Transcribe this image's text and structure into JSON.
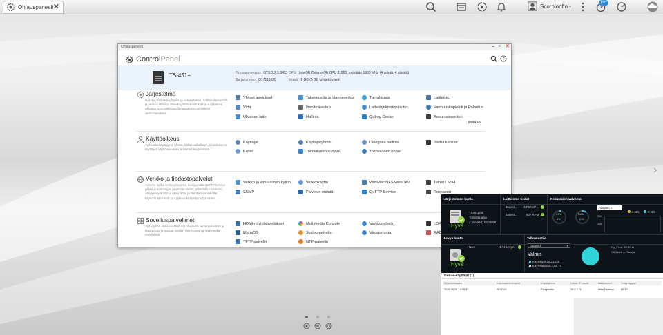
{
  "topbar": {
    "tab_label": "Ohjauspaneeli",
    "username": "Scorpionfin",
    "notification_count": "10+"
  },
  "window": {
    "title": "Ohjauspaneeli",
    "app_name_1": "Control",
    "app_name_2": "Panel",
    "nas_name": "TS-451+",
    "firmware_label": "Firmware-versio:",
    "firmware_value": "QTS 5.2.5.3451",
    "serial_label": "Sarjanumero:",
    "serial_value": "Q17116635",
    "cpu_label": "CPU:",
    "cpu_value": "Intel(R) Celeron(R) CPU J1900, enintään 1900 MHz (4 ydintä, 4 säiettä)",
    "memory_label": "Muisti:",
    "memory_value": "8 GB (8 GB käytettävissä)"
  },
  "sections": [
    {
      "title": "Järjestelmä",
      "desc": "Voit muuttaa aikavyöhyke- ja kieliasetuksia, hallita tallennustila ja ulkoisia laitteita, ottaa käyttöön ilmoitukset ja suojauksen, päivittää NAS-laitteistoa ja palauttaa NAS-laitteen oletusasetukset.",
      "items": [
        "Yleiset asetukset",
        "Tallennustila ja tilannevedos",
        "Turvallisuus",
        "Laitteisto",
        "Virta",
        "Ilmoituskeskus",
        "Laiteohjelmistopäivitys",
        "Varmuuskopiointi ja Palautus",
        "Ulkoinen laite",
        "Hallinta",
        "QuLog Center",
        "Resurssimonitori"
      ],
      "more": "lisää>>"
    },
    {
      "title": "Käyttöoikeus",
      "desc": "Voit luoda käyttäjiä ja ryhmiä, hallita paikallisten ja toimialueen käyttäjien käyttöoikeuksia ja asettaa levykiintiöitä.",
      "items": [
        "Käyttäjät",
        "Käyttäjäryhmät",
        "Delegoitu hallinta",
        "Jaetut kansiot",
        "Kiintiö",
        "Toimialueen suojaus",
        "Toimialueen ohjain"
      ]
    },
    {
      "title": "Verkko ja tiedostopalvelut",
      "desc": "Voimme hallita verkkoyhteyksiä, konfiguroida QuFTP Service -palvelun tiedostojen jakamista varten, määrittää roskakorin säilytyskäytäntöjä ja ottaa NFS- ja WebDAV-protokollat käyttöön Microsoft- ja Apple-verkkoympäristöjä varten.",
      "items": [
        "Verkko ja virtuaalinen kytkin",
        "Verkkokäyttö",
        "Win/Mac/NFS/WebDAV",
        "Telnet / SSH",
        "SNMP",
        "Palvelun etsintä",
        "QuFTP Service",
        "Roskakori"
      ]
    },
    {
      "title": "Sovelluspalvelimet",
      "desc": "Voit käyttää verkkosisällön isännöinnissä verkkopalvelinta ja MariaDB:tä ja asettaa median indeksoinnin ja multimedia-sovelluksia.",
      "items": [
        "HDMI-näyttösovellukset",
        "Multimedia Console",
        "Verkkopalvelin",
        "LDAP",
        "MariaDB",
        "Syslog-palvelin",
        "Virustorjunta",
        "RADIUS",
        "TFTP palvelin",
        "NTP-palvelin"
      ]
    }
  ],
  "dashboard": {
    "health_title": "Järjestelmän kunto",
    "health_model": "TS451plus",
    "health_uptime_label": "Toiminta-aika",
    "health_uptime": "2 päivää(t) 03:35:58",
    "health_status": "Hyvä",
    "hw_title": "Laitteiston tiedot",
    "hw_row1_label": "Järjest...",
    "hw_row1_value": "43°C/107...",
    "hw_row2_label": "Järjest...",
    "hw_row2_value": "527 RPM",
    "res_title": "Resurssien valvonta",
    "res_cpu_label": "CPU",
    "res_cpu_value": "4%",
    "res_ram_label": "RAM",
    "res_ram_value": "11%",
    "res_adapter": "Adapteri 1",
    "res_rx": "1 kt/s",
    "res_tx": "0 kt/s",
    "res_axis1": "390",
    "res_axis2": "195",
    "disk_title": "Levyn kunto",
    "disk_label": "NAS",
    "disk_count": "4 / 4 Levyn",
    "disk_status": "Hyvä",
    "storage_title": "Tallennustila",
    "storage_select": "Datavol1",
    "storage_status": "Valmis",
    "storage_used": "Käytetty:6,16,22 GB",
    "storage_free": "Käytettävissä:2,56 Tt",
    "storage_pool1": "Oy_Pieni: 22,00 kt",
    "storage_pool2": "C6 Movit — Tavu(a)",
    "cpu_pct": 4,
    "ram_pct": 11
  },
  "online": {
    "title": "Online-käyttäjät (1)",
    "headers": [
      "Kirjautumisaika",
      "Kokonaistoimenpide",
      "Käyttäjänimi",
      "Lähde-IP-osoite",
      "Asiakasnimi",
      "Yhteystyyppi"
    ],
    "row": [
      "2026-06-26 14:08:33",
      "00:00:01",
      "Scorpionfin",
      "10.0.4.21",
      "Web Desktop",
      "HTTP"
    ]
  },
  "colors": {
    "accent": "#2a8de0",
    "good": "#8fd43a",
    "sysbar": "#eaf2fb",
    "dash_bg": "#0d1318"
  }
}
